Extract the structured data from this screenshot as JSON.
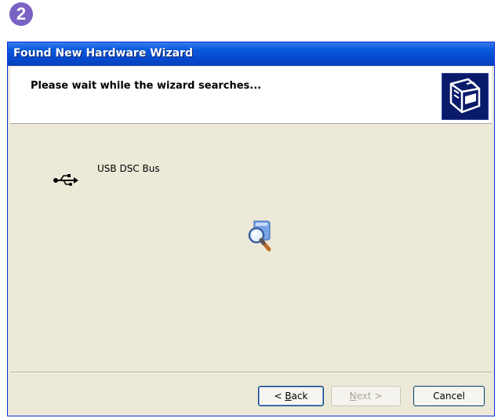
{
  "step_badge": "2",
  "window": {
    "title": "Found New Hardware Wizard"
  },
  "header": {
    "title": "Please wait while the wizard searches...",
    "icon": "hardware-wizard-icon"
  },
  "content": {
    "device_icon": "usb-icon",
    "device_label": "USB DSC Bus",
    "activity_icon": "search-magnifier-icon"
  },
  "buttons": {
    "back_prefix": "< ",
    "back_key": "B",
    "back_rest": "ack",
    "next_key": "N",
    "next_rest": "ext >",
    "cancel": "Cancel"
  },
  "colors": {
    "titlebar": "#0a5adb",
    "dialog_bg": "#ece9d8",
    "badge": "#7a62c4"
  }
}
